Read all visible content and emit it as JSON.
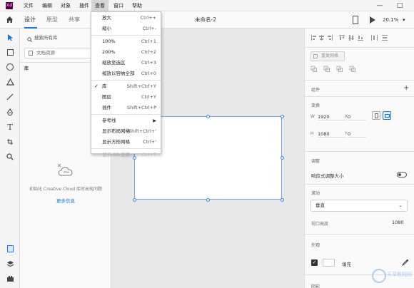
{
  "app": {
    "logo_text": "Xd"
  },
  "menubar": {
    "items": [
      "文件",
      "编辑",
      "对象",
      "插件",
      "查看",
      "窗口",
      "帮助"
    ],
    "active": "查看"
  },
  "window_controls": {
    "minimize": "—",
    "maximize": "□"
  },
  "toolbar": {
    "tabs": [
      {
        "label": "设计",
        "active": true
      },
      {
        "label": "原型",
        "active": false
      },
      {
        "label": "共享",
        "active": false
      }
    ],
    "doc_title": "未命名-2",
    "zoom": "20.1%",
    "zoom_arrow": "▾"
  },
  "view_menu": {
    "items": [
      {
        "label": "放大",
        "shortcut": "Ctrl++"
      },
      {
        "label": "缩小",
        "shortcut": "Ctrl+-"
      },
      {
        "sep": true
      },
      {
        "label": "100%",
        "shortcut": "Ctrl+1"
      },
      {
        "label": "200%",
        "shortcut": "Ctrl+2"
      },
      {
        "label": "缩放至选区",
        "shortcut": "Ctrl+3"
      },
      {
        "label": "缩放以容纳全部",
        "shortcut": "Ctrl+0"
      },
      {
        "sep": true
      },
      {
        "label": "库",
        "shortcut": "Shift+Ctrl+Y",
        "checked": true
      },
      {
        "label": "图层",
        "shortcut": "Ctrl+Y"
      },
      {
        "label": "插件",
        "shortcut": "Shift+Ctrl+P"
      },
      {
        "sep": true
      },
      {
        "label": "参考线",
        "submenu": true
      },
      {
        "label": "显示布局网格",
        "shortcut": "Shift+Ctrl+'"
      },
      {
        "label": "显示方形网格",
        "shortcut": "Ctrl+'"
      },
      {
        "sep": true
      },
      {
        "label": "显示 3D 变换",
        "shortcut": "Ctrl+T",
        "disabled": true
      }
    ],
    "check_glyph": "✓",
    "submenu_glyph": "▶"
  },
  "libraries": {
    "search_placeholder": "搜索所有库",
    "doc_assets": "文档资源",
    "section_label": "库",
    "cc_message": "初始化 Creative Cloud 库时出现问题",
    "more_info": "更多信息"
  },
  "properties": {
    "repeat_grid": "重复网格",
    "component_title": "组件",
    "transform_title": "变换",
    "w_label": "W",
    "w_value": "1920",
    "x_label": "X",
    "x_value": "0",
    "h_label": "H",
    "h_value": "1080",
    "y_label": "Y",
    "y_value": "0",
    "responsive_title": "调整",
    "responsive_label": "响应式调整大小",
    "scroll_title": "滚动",
    "scroll_value": "垂直",
    "viewport_label": "视口高度",
    "viewport_value": "1080",
    "appearance_title": "外观",
    "fill_label": "填充",
    "shadow_title": "阴影",
    "plus": "+",
    "check": "✓"
  },
  "watermark": {
    "line1": "天草教程网"
  },
  "colors": {
    "accent": "#1473e6",
    "brand_bg": "#470137",
    "brand_fg": "#ff61f6",
    "selection": "#7aa7e6"
  }
}
